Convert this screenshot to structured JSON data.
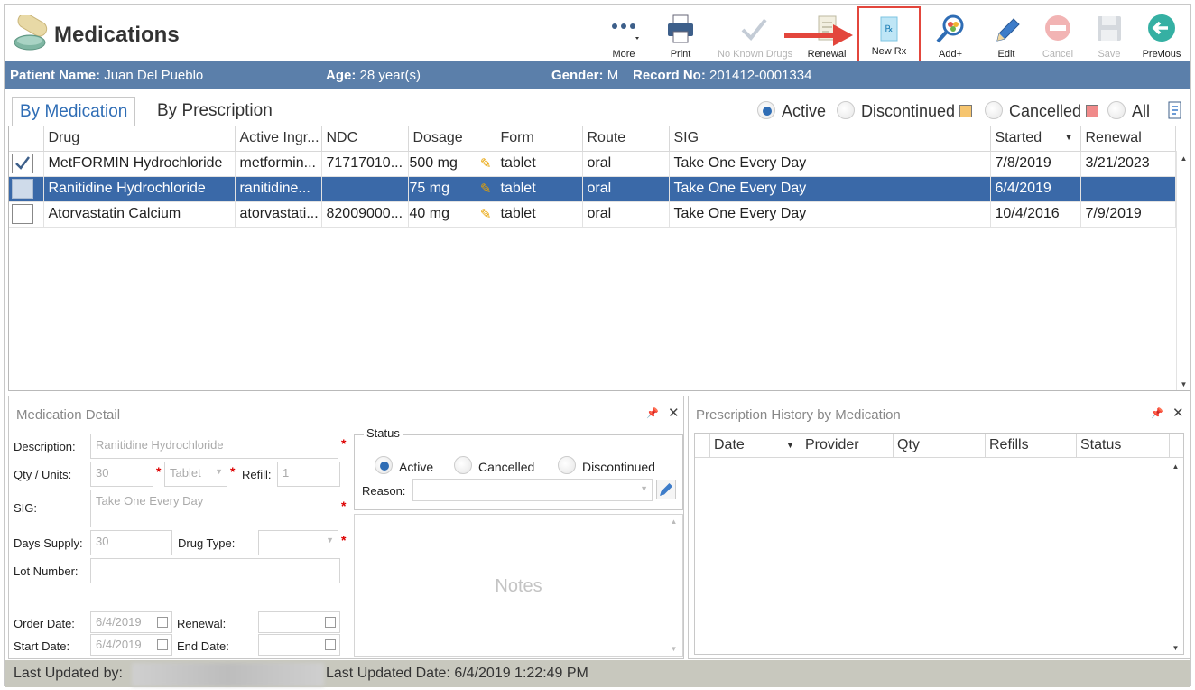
{
  "app": {
    "title": "Medications"
  },
  "toolbar": {
    "more": "More",
    "print": "Print",
    "no_known_drugs": "No Known Drugs",
    "renewal": "Renewal",
    "new_rx": "New Rx",
    "add_plus": "Add+",
    "edit": "Edit",
    "cancel": "Cancel",
    "save": "Save",
    "previous": "Previous"
  },
  "patient": {
    "name_label": "Patient Name:",
    "name": "Juan Del Pueblo",
    "age_label": "Age:",
    "age": "28 year(s)",
    "gender_label": "Gender:",
    "gender": "M",
    "record_label": "Record No:",
    "record": "201412-0001334"
  },
  "tabs": [
    "By Medication",
    "By Prescription"
  ],
  "filters": {
    "active": "Active",
    "discontinued": "Discontinued",
    "cancelled": "Cancelled",
    "all": "All",
    "selected": "Active",
    "discontinued_color": "#f6c56f",
    "cancelled_color": "#f08a8a"
  },
  "grid": {
    "columns": [
      "",
      "Drug",
      "Active Ingr...",
      "NDC",
      "Dosage",
      "Form",
      "Route",
      "SIG",
      "Started",
      "Renewal"
    ],
    "rows": [
      {
        "checked": true,
        "drug": "MetFORMIN Hydrochloride",
        "ingredient": "metformin...",
        "ndc": "71717010...",
        "dosage": "500 mg",
        "form": "tablet",
        "route": "oral",
        "sig": "Take One Every Day",
        "started": "7/8/2019",
        "renewal": "3/21/2023"
      },
      {
        "checked": false,
        "drug": "Ranitidine Hydrochloride",
        "ingredient": "ranitidine...",
        "ndc": "",
        "dosage": "75 mg",
        "form": "tablet",
        "route": "oral",
        "sig": "Take One Every Day",
        "started": "6/4/2019",
        "renewal": ""
      },
      {
        "checked": false,
        "drug": "Atorvastatin Calcium",
        "ingredient": "atorvastati...",
        "ndc": "82009000...",
        "dosage": "40 mg",
        "form": "tablet",
        "route": "oral",
        "sig": "Take One Every Day",
        "started": "10/4/2016",
        "renewal": "7/9/2019"
      }
    ],
    "selected_row": 1
  },
  "detail": {
    "title": "Medication Detail",
    "description_label": "Description:",
    "description": "Ranitidine Hydrochloride",
    "qty_label": "Qty / Units:",
    "qty": "30",
    "units": "Tablet",
    "refill_label": "Refill:",
    "refill": "1",
    "sig_label": "SIG:",
    "sig": "Take One Every Day",
    "days_supply_label": "Days Supply:",
    "days_supply": "30",
    "drug_type_label": "Drug Type:",
    "drug_type": "",
    "lot_label": "Lot Number:",
    "lot": "",
    "order_date_label": "Order Date:",
    "order_date": "6/4/2019",
    "renewal_label": "Renewal:",
    "renewal": "",
    "start_date_label": "Start Date:",
    "start_date": "6/4/2019",
    "end_date_label": "End Date:",
    "end_date": "",
    "status_label": "Status",
    "status_active": "Active",
    "status_cancelled": "Cancelled",
    "status_discontinued": "Discontinued",
    "status_selected": "Active",
    "reason_label": "Reason:",
    "reason": "",
    "notes_placeholder": "Notes"
  },
  "history": {
    "title": "Prescription History by Medication",
    "columns": [
      "Date",
      "Provider",
      "Qty",
      "Refills",
      "Status"
    ]
  },
  "footer": {
    "updated_by_label": "Last Updated by:",
    "updated_date_label": "Last Updated Date:",
    "updated_date": "6/4/2019 1:22:49 PM"
  }
}
